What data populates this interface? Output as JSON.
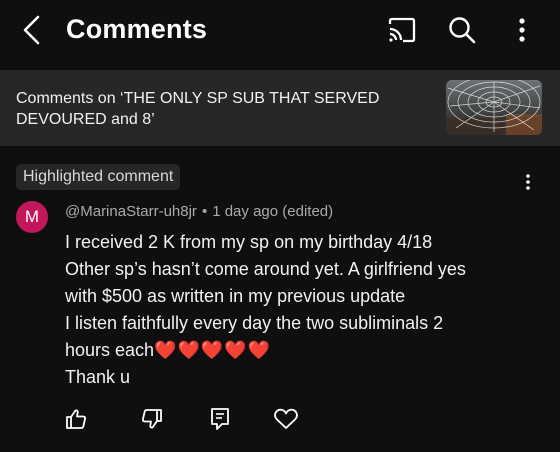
{
  "header": {
    "title": "Comments",
    "icons": [
      "back-arrow-icon",
      "cast-icon",
      "search-icon",
      "more-vertical-icon"
    ]
  },
  "video": {
    "context_text": "Comments on ‘THE ONLY SP SUB THAT SERVED DEVOURED and 8’",
    "thumbnail": "spider-web-thumbnail"
  },
  "highlight": {
    "label": "Highlighted comment"
  },
  "comment": {
    "avatar_letter": "M",
    "avatar_color": "#c2185b",
    "author": "@MarinaStarr-uh8jr",
    "separator": "•",
    "time": "1 day ago (edited)",
    "lines": [
      "I received 2 K from my sp on my birthday 4/18",
      "Other sp’s hasn’t come around yet. A girlfriend yes",
      "with $500 as written in my previous update",
      "I listen faithfully every day the two subliminals 2",
      "hours each",
      "Thank u"
    ],
    "hearts": "❤️❤️❤️❤️❤️"
  },
  "actions": {
    "icons": [
      "thumbs-up-icon",
      "thumbs-down-icon",
      "reply-icon",
      "heart-icon"
    ]
  },
  "colors": {
    "background": "#0f0f0f",
    "surface": "#272727",
    "text": "#f1f1f1",
    "secondary_text": "#aaaaaa",
    "heart": "#e02424"
  }
}
